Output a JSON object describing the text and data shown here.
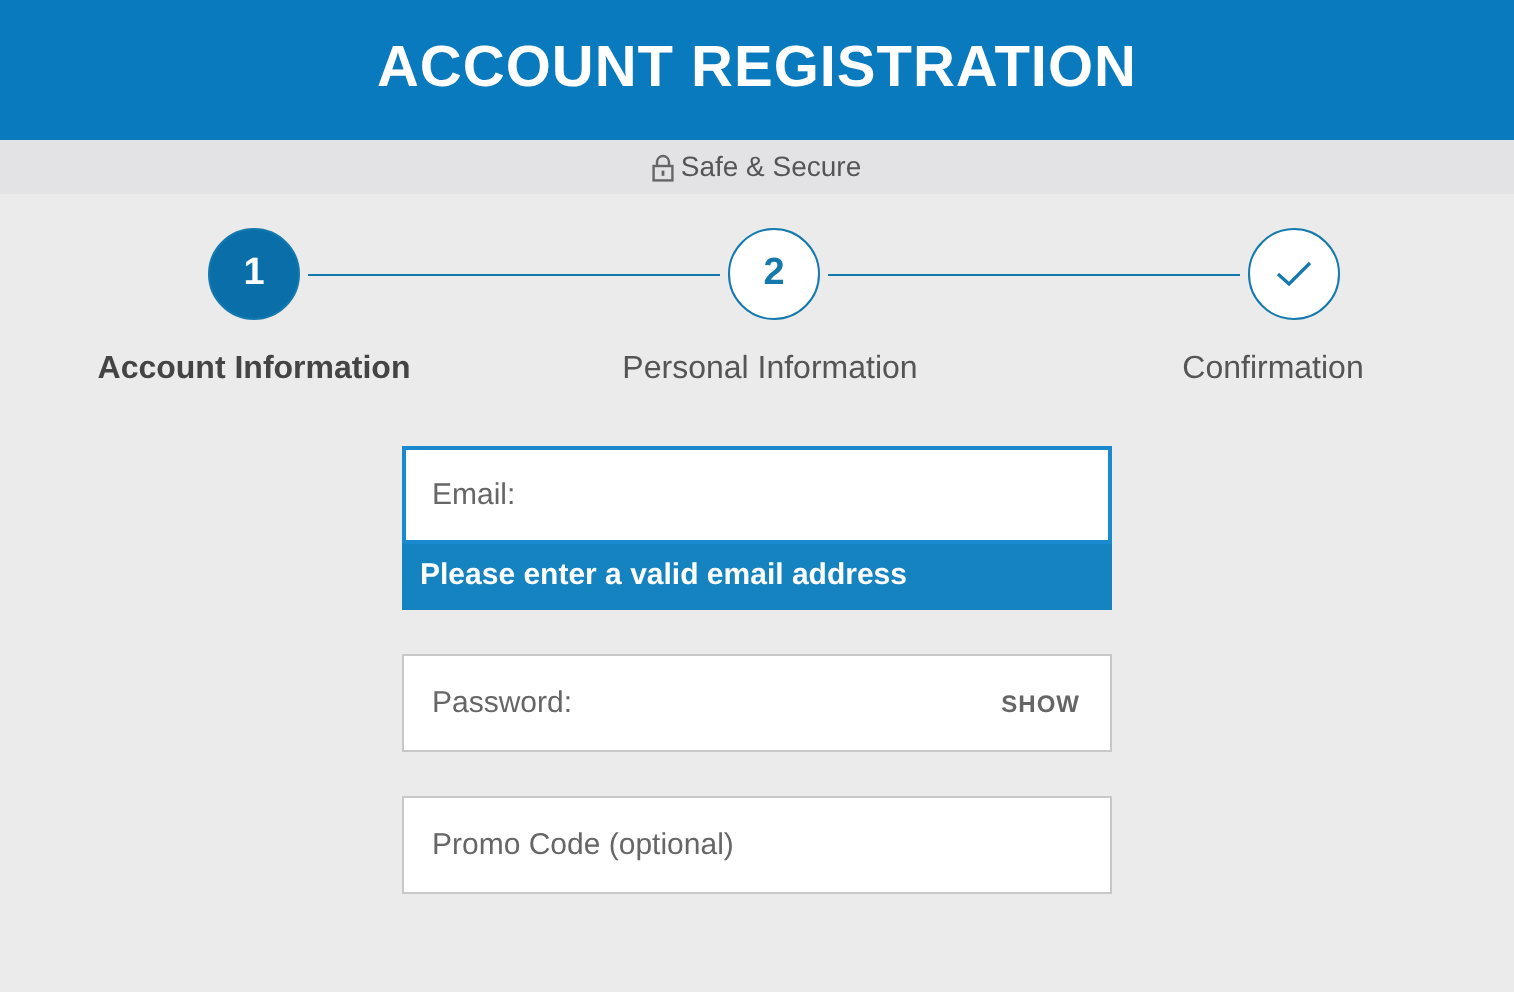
{
  "header": {
    "title": "ACCOUNT REGISTRATION"
  },
  "security_note": {
    "text": "Safe & Secure"
  },
  "steps": [
    {
      "kind": "number",
      "badge": "1",
      "label": "Account Information",
      "selected": true
    },
    {
      "kind": "number",
      "badge": "2",
      "label": "Personal Information",
      "selected": false
    },
    {
      "kind": "check",
      "label": "Confirmation",
      "selected": false
    }
  ],
  "fields": [
    {
      "placeholder": "Email:",
      "focused": true,
      "error": "Please enter a valid email address"
    },
    {
      "placeholder": "Password:",
      "focused": false,
      "action": "SHOW"
    },
    {
      "placeholder": "Promo Code (optional)",
      "focused": false
    }
  ]
}
